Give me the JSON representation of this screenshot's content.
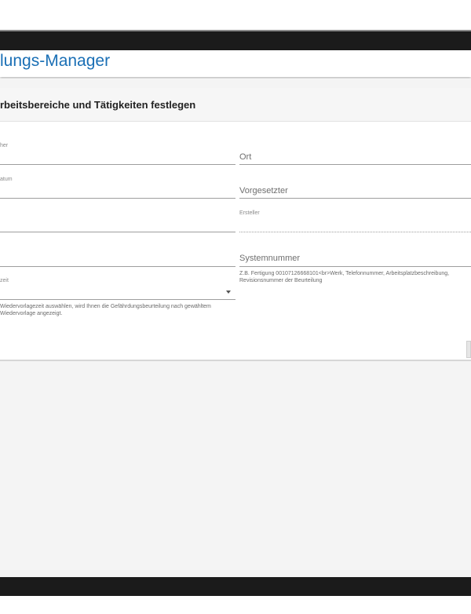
{
  "app": {
    "title": "lungs-Manager"
  },
  "card": {
    "title": "rbeitsbereiche und Tätigkeiten festlegen"
  },
  "form": {
    "left": {
      "f1_label": "her",
      "f2_label": "atum",
      "select_label": "zeit",
      "select_hint_line1": "Wiedervorlagezeit auswählen, wird Ihnen die Gefährdungsbeurteilung nach gewähltem",
      "select_hint_line2": "Wiedervorlage angezeigt."
    },
    "right": {
      "ort_label": "Ort",
      "vorgesetzter_label": "Vorgesetzter",
      "ersteller_label": "Ersteller",
      "systemnummer_label": "Systemnummer",
      "systemnummer_hint_line1": "Z.B. Fertigung 00107126668101<br>Werk, Telefonnummer, Arbeitsplatzbeschreibung,",
      "systemnummer_hint_line2": "Revisionsnummer der Beurteilung"
    }
  }
}
